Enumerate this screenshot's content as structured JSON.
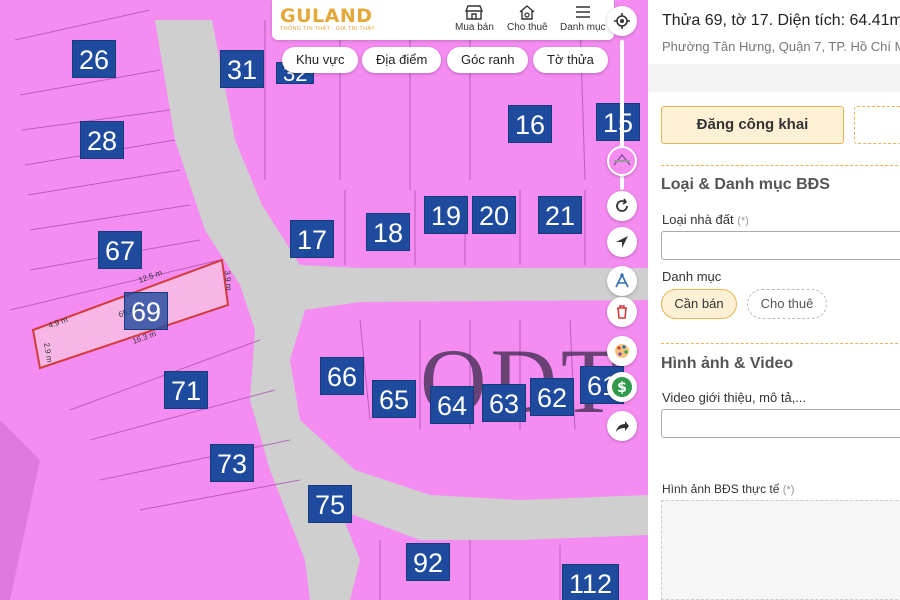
{
  "header": {
    "logo_text": "GULAND",
    "logo_tagline": "THÔNG TIN THẬT · GIÁ TRỊ THẬT",
    "nav": [
      {
        "label": "Mua bán",
        "icon": "shop-icon"
      },
      {
        "label": "Cho thuê",
        "icon": "house-key-icon"
      },
      {
        "label": "Danh mục",
        "icon": "menu-icon"
      }
    ]
  },
  "filters": [
    "Khu vực",
    "Địa điểm",
    "Góc ranh",
    "Tờ thửa"
  ],
  "map": {
    "lot_numbers": [
      "26",
      "28",
      "31",
      "32",
      "16",
      "15",
      "19",
      "20",
      "21",
      "17",
      "18",
      "67",
      "69",
      "71",
      "73",
      "75",
      "66",
      "65",
      "64",
      "63",
      "62",
      "61",
      "92",
      "112"
    ],
    "zone_label": "ODT",
    "parcel": {
      "area": "65.4 m²",
      "edges": [
        "12.5 m",
        "3.9 m",
        "16.3 m",
        "4.9 m",
        "2.9 m"
      ]
    },
    "tools": [
      "locate-icon",
      "refresh-icon",
      "navigate-icon",
      "measure-icon",
      "trash-icon",
      "palette-icon",
      "dollar-icon",
      "share-icon"
    ]
  },
  "panel": {
    "title": "Thửa 69, tờ 17. Diện tích: 64.41m",
    "address": "Phường Tân Hưng, Quận 7, TP. Hồ Chí M",
    "publish_label": "Đăng công khai",
    "section_category": "Loại & Danh mục BĐS",
    "land_type_label": "Loại nhà đất",
    "category_label": "Danh mục",
    "category_options": [
      "Cần bán",
      "Cho thuê"
    ],
    "section_media": "Hình ảnh & Video",
    "video_label": "Video giới thiệu, mô tả,...",
    "photo_label": "Hình ảnh BĐS thực tế",
    "required_mark": "(*)"
  },
  "colors": {
    "land": "#f58cf2",
    "road": "#cfcfcf",
    "lot_badge": "#1e4b9e",
    "accent": "#e5b45a"
  }
}
